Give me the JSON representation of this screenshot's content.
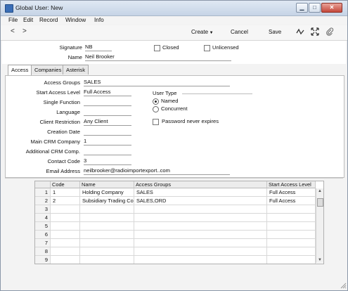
{
  "window": {
    "title": "Global User: New"
  },
  "menu": [
    "File",
    "Edit",
    "Record",
    "Window",
    "Info"
  ],
  "toolbar": {
    "prev": "<",
    "next": ">",
    "create": "Create",
    "cancel": "Cancel",
    "save": "Save"
  },
  "header": {
    "signature_label": "Signature",
    "signature": "NB",
    "name_label": "Name",
    "name": "Neil Brooker",
    "closed_label": "Closed",
    "closed": false,
    "unlicensed_label": "Unlicensed",
    "unlicensed": false
  },
  "tabs": [
    {
      "label": "Access",
      "active": true
    },
    {
      "label": "Companies",
      "active": false
    },
    {
      "label": "Asterisk",
      "active": false
    }
  ],
  "access": {
    "access_groups_label": "Access Groups",
    "access_groups": "SALES",
    "start_access_level_label": "Start Access Level",
    "start_access_level": "Full Access",
    "single_function_label": "Single Function",
    "single_function": "",
    "language_label": "Language",
    "language": "",
    "client_restriction_label": "Client Restriction",
    "client_restriction": "Any Client",
    "creation_date_label": "Creation Date",
    "creation_date": "",
    "main_crm_company_label": "Main CRM Company",
    "main_crm_company": "1",
    "additional_crm_label": "Additional CRM Comp.",
    "additional_crm": "",
    "contact_code_label": "Contact Code",
    "contact_code": "3",
    "email_label": "Email Address",
    "email": "neilbrooker@radioimportexport..com",
    "user_type_label": "User Type",
    "user_type_options": [
      "Named",
      "Concurrent"
    ],
    "user_type_selected": "Named",
    "password_never_expires_label": "Password never expires",
    "password_never_expires": false
  },
  "grid": {
    "columns": [
      "Code",
      "Name",
      "Access Groups",
      "Start Access Level"
    ],
    "rows": [
      {
        "n": "1",
        "code": "1",
        "name": "Holding Company",
        "groups": "SALES",
        "level": "Full Access"
      },
      {
        "n": "2",
        "code": "2",
        "name": "Subsidiary Trading Co",
        "groups": "SALES,ORD",
        "level": "Full Access"
      },
      {
        "n": "3",
        "code": "",
        "name": "",
        "groups": "",
        "level": ""
      },
      {
        "n": "4",
        "code": "",
        "name": "",
        "groups": "",
        "level": ""
      },
      {
        "n": "5",
        "code": "",
        "name": "",
        "groups": "",
        "level": ""
      },
      {
        "n": "6",
        "code": "",
        "name": "",
        "groups": "",
        "level": ""
      },
      {
        "n": "7",
        "code": "",
        "name": "",
        "groups": "",
        "level": ""
      },
      {
        "n": "8",
        "code": "",
        "name": "",
        "groups": "",
        "level": ""
      },
      {
        "n": "9",
        "code": "",
        "name": "",
        "groups": "",
        "level": ""
      }
    ]
  }
}
